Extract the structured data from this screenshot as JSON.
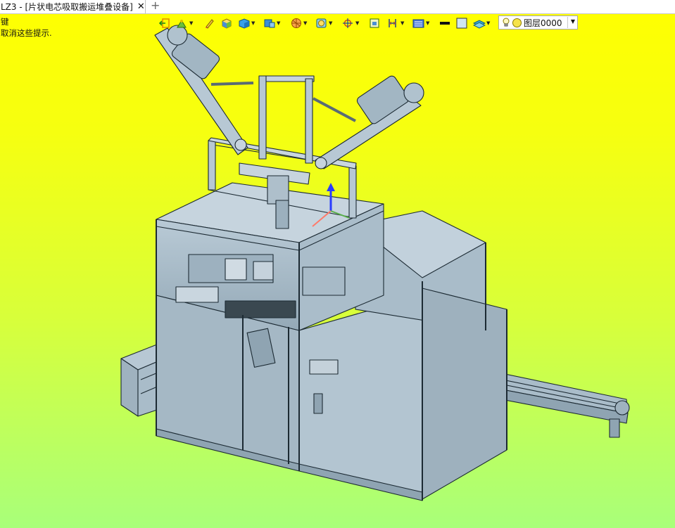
{
  "tab": {
    "title": "LZ3 - [片状电芯吸取搬运堆叠设备]",
    "close_glyph": "✕",
    "new_tab_glyph": "+"
  },
  "prompt": {
    "line1": "键",
    "line2": "取消这些提示."
  },
  "toolbar": {
    "items": [
      {
        "icon": "exit-icon"
      },
      {
        "icon": "snap-icon"
      },
      {
        "icon": "pencil-icon"
      },
      {
        "icon": "box-icon"
      },
      {
        "icon": "solid-icon"
      },
      {
        "icon": "view-icon"
      },
      {
        "icon": "render-icon"
      },
      {
        "icon": "shade-icon"
      },
      {
        "icon": "crosshair-icon"
      },
      {
        "icon": "fit-icon"
      },
      {
        "icon": "measure-icon"
      },
      {
        "icon": "layers-icon"
      },
      {
        "icon": "line-color-icon"
      },
      {
        "icon": "fill-color-icon"
      },
      {
        "icon": "stack-icon"
      }
    ],
    "layer_name": "图层0000"
  },
  "colors": {
    "bg_top": "#ffff00",
    "bg_bottom": "#a8ff7a",
    "metal": "#b7c8d4",
    "metal_dark": "#8fa4b2"
  }
}
